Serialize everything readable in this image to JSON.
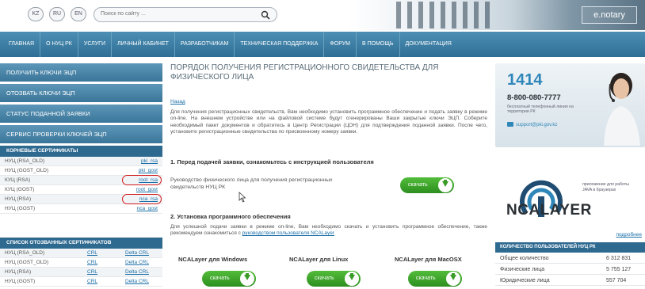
{
  "languages": [
    "KZ",
    "RU",
    "EN"
  ],
  "search": {
    "placeholder": "Поиск по сайту ..."
  },
  "brand": "e.notary",
  "nav": [
    "ГЛАВНАЯ",
    "О НУЦ РК",
    "УСЛУГИ",
    "ЛИЧНЫЙ КАБИНЕТ",
    "РАЗРАБОТЧИКАМ",
    "ТЕХНИЧЕСКАЯ ПОДДЕРЖКА",
    "ФОРУМ",
    "В ПОМОЩЬ",
    "ДОКУМЕНТАЦИЯ"
  ],
  "sidebar": {
    "buttons": [
      "ПОЛУЧИТЬ КЛЮЧИ ЭЦП",
      "ОТОЗВАТЬ КЛЮЧИ ЭЦП",
      "СТАТУС ПОДАННОЙ ЗАЯВКИ",
      "СЕРВИС ПРОВЕРКИ КЛЮЧЕЙ ЭЦП"
    ],
    "root_head": "КОРНЕВЫЕ СЕРТИФИКАТЫ",
    "root_rows": [
      {
        "name": "НУЦ (RSA_OLD)",
        "link": "pki_rsa"
      },
      {
        "name": "НУЦ (GOST_OLD)",
        "link": "pki_gost"
      },
      {
        "name": "КУЦ (RSA)",
        "link": "root_rsa"
      },
      {
        "name": "КУЦ (GOST)",
        "link": "root_gost"
      },
      {
        "name": "НУЦ (RSA)",
        "link": "nca_rsa"
      },
      {
        "name": "НУЦ (GOST)",
        "link": "nca_gost"
      }
    ],
    "revoked_head": "СПИСОК ОТОЗВАННЫХ СЕРТИФИКАТОВ",
    "revoked_rows": [
      {
        "name": "НУЦ (RSA_OLD)",
        "crl": "CRL",
        "delta": "Delta CRL"
      },
      {
        "name": "НУЦ (GOST_OLD)",
        "crl": "CRL",
        "delta": "Delta CRL"
      },
      {
        "name": "НУЦ (RSA)",
        "crl": "CRL",
        "delta": "Delta CRL"
      },
      {
        "name": "НУЦ (GOST)",
        "crl": "CRL",
        "delta": "Delta CRL"
      }
    ]
  },
  "main": {
    "title": "ПОРЯДОК ПОЛУЧЕНИЯ РЕГИСТРАЦИОННОГО СВИДЕТЕЛЬСТВА ДЛЯ ФИЗИЧЕСКОГО ЛИЦА",
    "back": "Назад",
    "intro": "Для получения регистрационных свидетельств, Вам необходимо установить программное обеспечение и подать заявку в режиме on-line. На внешнем устройстве или на файловой системе будут сгенерированы Ваши закрытые ключи ЭЦП. Соберите необходимый пакет документов и обратитесь в Центр Регистрации (ЦОН) для подтверждения поданной заявки. После чего, установите регистрационные свидетельства по присвоенному номеру заявки.",
    "step1": "1. Перед подачей заявки, ознакомьтесь с инструкцией пользователя",
    "guide": "Руководство физического лица для получения регистрационных свидетельств НУЦ РК",
    "download": "скачать",
    "step2": "2. Установка программного обеспечения",
    "install_text": "Для успешной подачи заявки в режиме on-line, Вам необходимо скачать и установить программное обеспечение, также рекомендуем ознакомиться с",
    "install_link": "руководством пользователя NCALayer",
    "columns": [
      "NCALayer для Windows",
      "NCALayer для Linux",
      "NCALayer для MacOSX"
    ]
  },
  "right": {
    "short_number": "1414",
    "phone": "8-800-080-7777",
    "free_text": "бесплатный телефонный линия на территории РК",
    "email": "support@pki.gov.kz",
    "nca_logo": "NCALAYER",
    "nca_side": "приложение для работы JAVA в браузерах",
    "more": "подробнее",
    "users_head": "КОЛИЧЕСТВО ПОЛЬЗОВАТЕЛЕЙ НУЦ РК",
    "users": [
      {
        "label": "Общее количество",
        "value": "6 312 831"
      },
      {
        "label": "Физические лица",
        "value": "5 755 127"
      },
      {
        "label": "Юридические лица",
        "value": "557 704"
      }
    ]
  }
}
